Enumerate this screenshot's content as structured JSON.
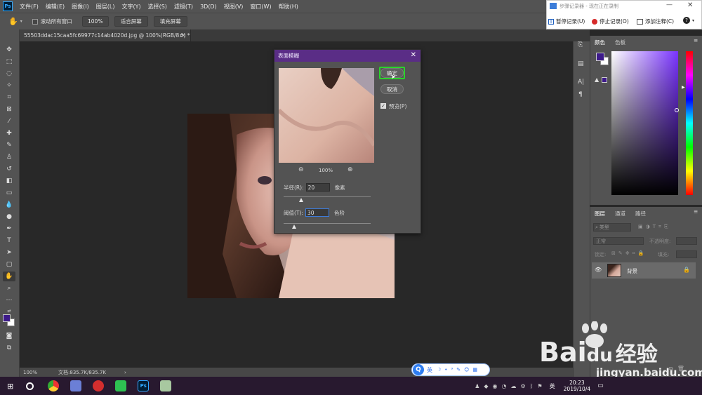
{
  "menubar": {
    "app_icon": "Ps",
    "items": [
      "文件(F)",
      "编辑(E)",
      "图像(I)",
      "图层(L)",
      "文字(Y)",
      "选择(S)",
      "滤镜(T)",
      "3D(D)",
      "视图(V)",
      "窗口(W)",
      "帮助(H)"
    ]
  },
  "optionsbar": {
    "scroll_all": "滚动所有窗口",
    "zoom": "100%",
    "fit_screen": "适合屏幕",
    "fill_screen": "填充屏幕"
  },
  "document": {
    "tab_title": "55503ddac15caa5fc69977c14ab4020d.jpg @ 100%(RGB/8#) *",
    "close": "×"
  },
  "dialog": {
    "title": "表面模糊",
    "close": "✕",
    "ok": "确定",
    "cancel": "取消",
    "preview_label": "预览(P)",
    "zoom": "100%",
    "radius_label": "半径(R):",
    "radius_value": "20",
    "radius_unit": "像素",
    "radius_slider": 0.2,
    "threshold_label": "阈值(T):",
    "threshold_value": "30",
    "threshold_unit": "色阶",
    "threshold_slider": 0.12
  },
  "panels": {
    "color_tab": "颜色",
    "swatches_tab": "色板",
    "layers_tab": "图层",
    "channels_tab": "通道",
    "paths_tab": "路径",
    "kind_placeholder": "类型",
    "blend_mode": "正常",
    "opacity_label": "不透明度:",
    "lock_label": "锁定:",
    "fill_label": "填充:",
    "layer_name": "背景",
    "foreground_color": "#3d1a8a",
    "background_color": "#ffffff"
  },
  "status": {
    "zoom": "100%",
    "doc": "文档:835.7K/835.7K",
    "arrow": "›"
  },
  "recorder": {
    "title": "步骤记录器 - 现在正在录制",
    "pause": "暂停记录(U)",
    "stop": "停止记录(O)",
    "add_comment": "添加注释(C)",
    "help": "?"
  },
  "ime": {
    "lang": "英"
  },
  "taskbar": {
    "time": "20:23",
    "date": "2019/10/4",
    "lang": "英"
  },
  "watermark": {
    "brand": "Bai",
    "brand2": "经验",
    "du": "du",
    "url": "jingyan.baidu.com"
  }
}
